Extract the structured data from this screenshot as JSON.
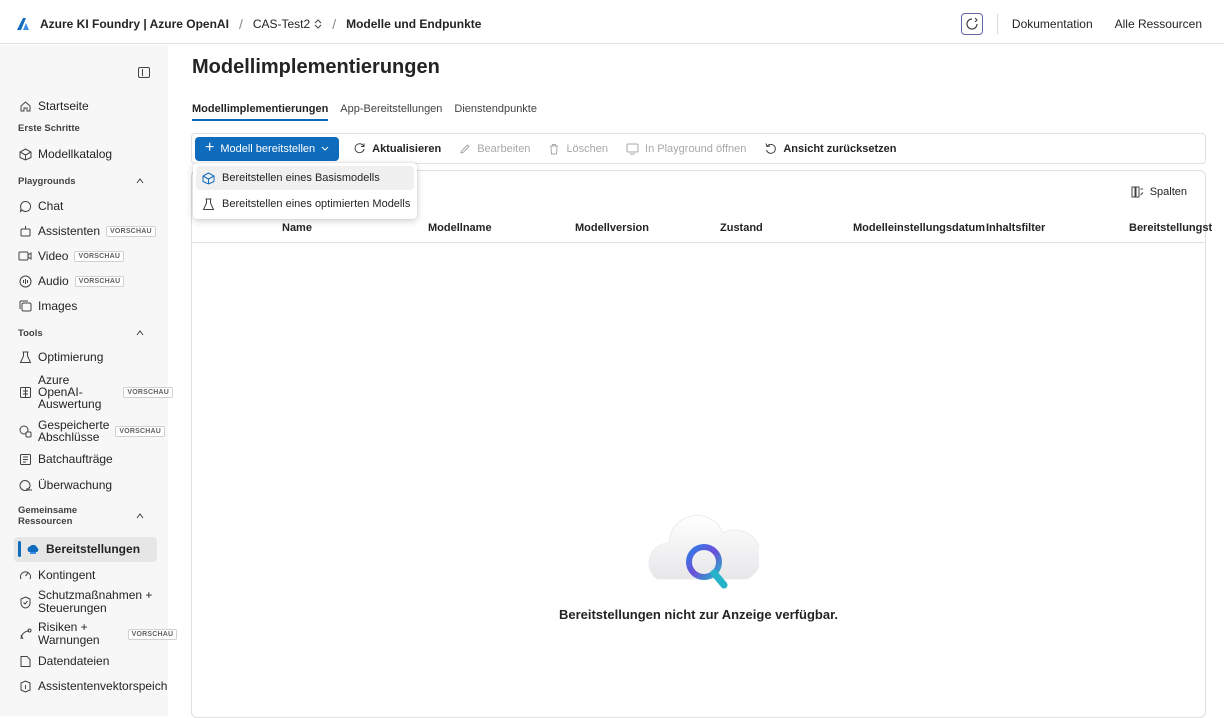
{
  "topbar": {
    "app_name": "Azure KI Foundry | Azure OpenAI",
    "project": "CAS-Test2",
    "current_page": "Modelle und Endpunkte",
    "documentation": "Dokumentation",
    "all_resources": "Alle Ressourcen"
  },
  "sidebar": {
    "home": "Startseite",
    "section_getting_started": "Erste Schritte",
    "model_catalog": "Modellkatalog",
    "section_playgrounds": "Playgrounds",
    "chat": "Chat",
    "assistants": "Assistenten",
    "video": "Video",
    "audio": "Audio",
    "images": "Images",
    "section_tools": "Tools",
    "optimization": "Optimierung",
    "eval_line1": "Azure",
    "eval_line2": "OpenAI-",
    "eval_line3": "Auswertung",
    "stored_line1": "Gespeicherte",
    "stored_line2": "Abschlüsse",
    "batch_jobs": "Batchaufträge",
    "monitoring": "Überwachung",
    "section_shared_line1": "Gemeinsame",
    "section_shared_line2": "Ressourcen",
    "deployments": "Bereitstellungen",
    "quota": "Kontingent",
    "safety_line1": "Schutzmaßnahmen +",
    "safety_line2": "Steuerungen",
    "risks_line1": "Risiken +",
    "risks_line2": "Warnungen",
    "data_files": "Datendateien",
    "vector_stores": "Assistentenvektorspeich",
    "badge_preview": "VORSCHAU"
  },
  "main": {
    "title": "Modellimplementierungen",
    "tabs": [
      "Modellimplementierungen",
      "App-Bereitstellungen",
      "Dienstendpunkte"
    ],
    "toolbar": {
      "deploy": "Modell bereitstellen",
      "refresh": "Aktualisieren",
      "edit": "Bearbeiten",
      "delete": "Löschen",
      "open_playground": "In Playground öffnen",
      "reset_view": "Ansicht zurücksetzen"
    },
    "columns_button": "Spalten",
    "columns": [
      "Name",
      "Modellname",
      "Modellversion",
      "Zustand",
      "Modelleinstellungsdatum",
      "Inhaltsfilter",
      "Bereitstellungst"
    ],
    "empty_message": "Bereitstellungen nicht zur Anzeige verfügbar."
  },
  "dropdown": {
    "items": [
      "Bereitstellen eines Basismodells",
      "Bereitstellen eines optimierten Modells"
    ]
  },
  "colors": {
    "accent": "#0f6cbd",
    "sidebar_bg": "#f7f7f7"
  }
}
